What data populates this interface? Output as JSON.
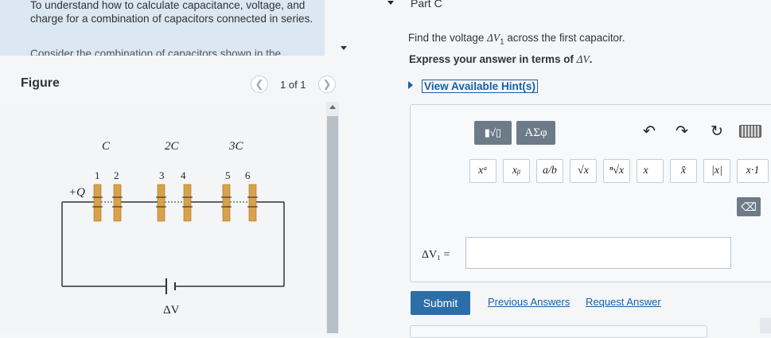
{
  "intro": {
    "text": "To understand how to calculate capacitance, voltage, and charge for a combination of capacitors connected in series.",
    "more": "Consider the combination of capacitors shown in the"
  },
  "figure": {
    "title": "Figure",
    "pager": "1 of 1",
    "prev_icon": "chevron-left-icon",
    "next_icon": "chevron-right-icon",
    "cap_labels": [
      "C",
      "2C",
      "3C"
    ],
    "plate_labels": [
      "1",
      "2",
      "3",
      "4",
      "5",
      "6"
    ],
    "charge_label": "+Q",
    "voltage_label": "ΔV",
    "plate_color": "#d9a24a"
  },
  "part": {
    "label": "Part C",
    "question_prefix": "Find the voltage ",
    "question_var": "ΔV",
    "question_sub": "1",
    "question_suffix": " across the first capacitor.",
    "instruction_prefix": "Express your answer in terms of ",
    "instruction_var": "ΔV",
    "instruction_suffix": ".",
    "hint": "View Available Hint(s)"
  },
  "toolbar": {
    "template_label": "▮√▯",
    "greek_label": "ΑΣφ",
    "undo": "↶",
    "redo": "↷",
    "reset": "↻",
    "symbols": [
      "xᵃ",
      "xᵦ",
      "a/b",
      "√x",
      "ⁿ√x",
      "x⃗",
      "x̂",
      "|x|",
      "x·1"
    ],
    "backspace": "⌫"
  },
  "answer": {
    "label": "ΔV₁ =",
    "value": ""
  },
  "actions": {
    "submit": "Submit",
    "previous_answers": "Previous Answers",
    "request_answer": "Request Answer"
  },
  "colors": {
    "accent": "#2b6ea8",
    "link": "#1a5fa8",
    "intro_bg": "#dbe7f2"
  }
}
